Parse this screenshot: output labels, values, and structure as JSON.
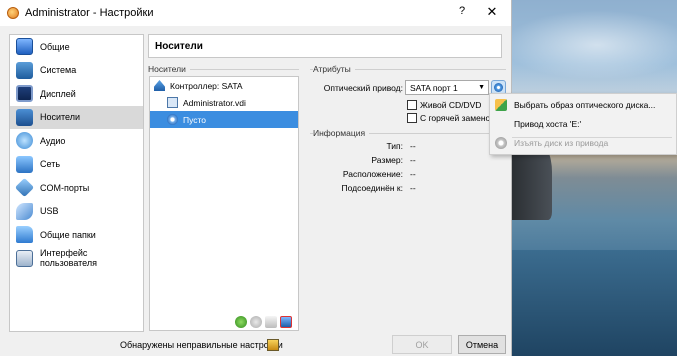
{
  "window": {
    "title": "Administrator - Настройки",
    "help_label": "?",
    "close_label": "✕"
  },
  "sidebar": {
    "items": [
      {
        "label": "Общие",
        "icon": "general-icon"
      },
      {
        "label": "Система",
        "icon": "system-icon"
      },
      {
        "label": "Дисплей",
        "icon": "display-icon"
      },
      {
        "label": "Носители",
        "icon": "storage-icon",
        "selected": true
      },
      {
        "label": "Аудио",
        "icon": "audio-icon"
      },
      {
        "label": "Сеть",
        "icon": "network-icon"
      },
      {
        "label": "COM-порты",
        "icon": "serial-ports-icon"
      },
      {
        "label": "USB",
        "icon": "usb-icon"
      },
      {
        "label": "Общие папки",
        "icon": "shared-folders-icon"
      },
      {
        "label": "Интерфейс пользователя",
        "icon": "user-interface-icon"
      }
    ]
  },
  "main": {
    "section_title": "Носители",
    "storage_group_label": "Носители",
    "tree": [
      {
        "label": "Контроллер: SATA",
        "icon": "controller-icon"
      },
      {
        "label": "Administrator.vdi",
        "icon": "hard-disk-icon"
      },
      {
        "label": "Пусто",
        "icon": "optical-disc-icon",
        "selected": true
      }
    ],
    "attributes": {
      "group_label": "Атрибуты",
      "optical_drive_label": "Оптический привод:",
      "optical_drive_value": "SATA порт 1",
      "live_cd_label": "Живой CD/DVD",
      "hot_plug_label": "С горячей заменой"
    },
    "information": {
      "group_label": "Информация",
      "rows": [
        {
          "key": "Тип:",
          "value": "--"
        },
        {
          "key": "Размер:",
          "value": "--"
        },
        {
          "key": "Расположение:",
          "value": "--"
        },
        {
          "key": "Подсоединён к:",
          "value": "--"
        }
      ]
    }
  },
  "footer": {
    "status_text": "Обнаружены неправильные настройки",
    "ok_label": "OK",
    "cancel_label": "Отмена"
  },
  "context_menu": {
    "items": [
      {
        "label": "Выбрать образ оптического диска...",
        "enabled": true
      },
      {
        "label": "Привод хоста 'E:'",
        "enabled": true
      },
      {
        "label": "Изъять диск из привода",
        "enabled": false
      }
    ]
  }
}
